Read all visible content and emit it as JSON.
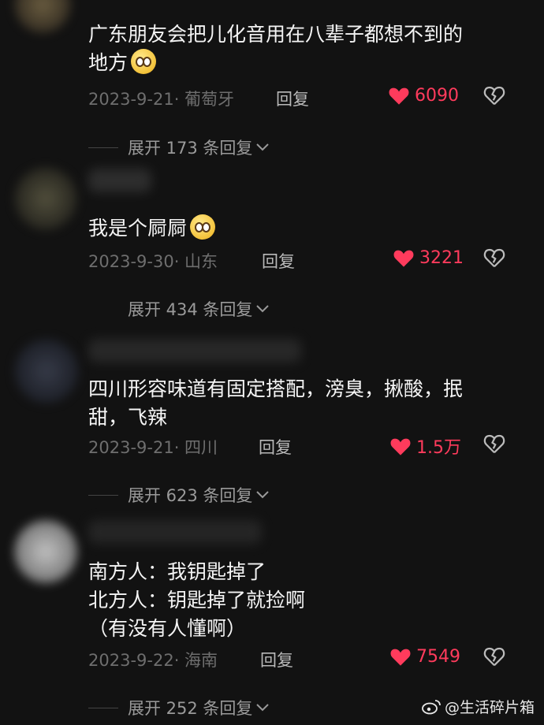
{
  "comments": [
    {
      "content": "广东朋友会把儿化音用在八辈子都想不到的\n地方",
      "emoji": "smiling-face-emoji",
      "date": "2023-9-21",
      "location": "葡萄牙",
      "reply_label": "回复",
      "likes": "6090",
      "expand_label": "展开 173 条回复"
    },
    {
      "content": "我是个屙屙",
      "emoji": "pleading-face-emoji",
      "date": "2023-9-30",
      "location": "山东",
      "reply_label": "回复",
      "likes": "3221",
      "expand_label": "展开 434 条回复"
    },
    {
      "content": "四川形容味道有固定搭配，滂臭，揪酸，抿\n甜，飞辣",
      "date": "2023-9-21",
      "location": "四川",
      "reply_label": "回复",
      "likes": "1.5万",
      "expand_label": "展开 623 条回复"
    },
    {
      "content": "南方人：我钥匙掉了\n北方人：钥匙掉了就捡啊\n（有没有人懂啊）",
      "date": "2023-9-22",
      "location": "海南",
      "reply_label": "回复",
      "likes": "7549",
      "expand_label": "展开 252 条回复"
    }
  ],
  "colors": {
    "background": "#121212",
    "like": "#ff3b5c",
    "meta": "#6e6e6e"
  },
  "watermark": "@生活碎片箱"
}
